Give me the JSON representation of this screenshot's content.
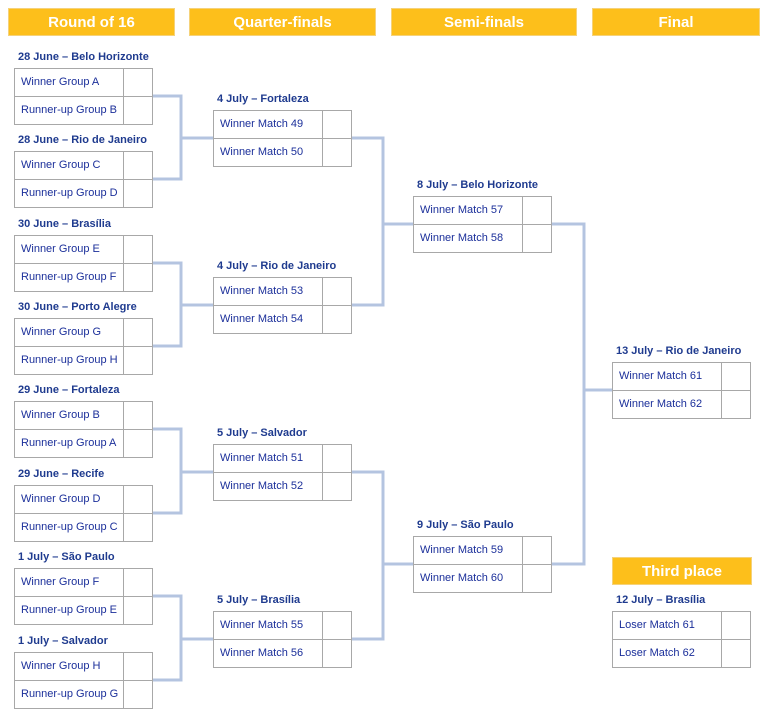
{
  "headers": {
    "r16": "Round of 16",
    "qf": "Quarter-finals",
    "sf": "Semi-finals",
    "final": "Final",
    "third": "Third place"
  },
  "colors": {
    "header": "#fdbf1b",
    "connector": "#b4c4e0",
    "text": "#1b2f9a"
  },
  "rounds": {
    "r16": [
      {
        "label": "28 June – Belo Horizonte",
        "teams": [
          "Winner Group A",
          "Runner-up Group B"
        ]
      },
      {
        "label": "28 June – Rio de Janeiro",
        "teams": [
          "Winner Group C",
          "Runner-up Group D"
        ]
      },
      {
        "label": "30 June – Brasília",
        "teams": [
          "Winner Group E",
          "Runner-up Group F"
        ]
      },
      {
        "label": "30 June – Porto Alegre",
        "teams": [
          "Winner Group G",
          "Runner-up Group H"
        ]
      },
      {
        "label": "29 June – Fortaleza",
        "teams": [
          "Winner Group B",
          "Runner-up Group A"
        ]
      },
      {
        "label": "29 June – Recife",
        "teams": [
          "Winner Group D",
          "Runner-up Group C"
        ]
      },
      {
        "label": "1 July – São Paulo",
        "teams": [
          "Winner Group F",
          "Runner-up Group E"
        ]
      },
      {
        "label": "1 July – Salvador",
        "teams": [
          "Winner Group H",
          "Runner-up Group G"
        ]
      }
    ],
    "qf": [
      {
        "label": "4 July – Fortaleza",
        "teams": [
          "Winner Match 49",
          "Winner Match 50"
        ]
      },
      {
        "label": "4 July – Rio de Janeiro",
        "teams": [
          "Winner Match 53",
          "Winner Match 54"
        ]
      },
      {
        "label": "5 July – Salvador",
        "teams": [
          "Winner Match 51",
          "Winner Match 52"
        ]
      },
      {
        "label": "5 July – Brasília",
        "teams": [
          "Winner Match 55",
          "Winner Match 56"
        ]
      }
    ],
    "sf": [
      {
        "label": "8 July – Belo Horizonte",
        "teams": [
          "Winner Match 57",
          "Winner Match 58"
        ]
      },
      {
        "label": "9 July – São Paulo",
        "teams": [
          "Winner Match 59",
          "Winner Match 60"
        ]
      }
    ],
    "final": [
      {
        "label": "13 July – Rio de Janeiro",
        "teams": [
          "Winner Match 61",
          "Winner Match 62"
        ]
      }
    ],
    "third": [
      {
        "label": "12 July – Brasília",
        "teams": [
          "Loser Match 61",
          "Loser Match 62"
        ]
      }
    ]
  }
}
